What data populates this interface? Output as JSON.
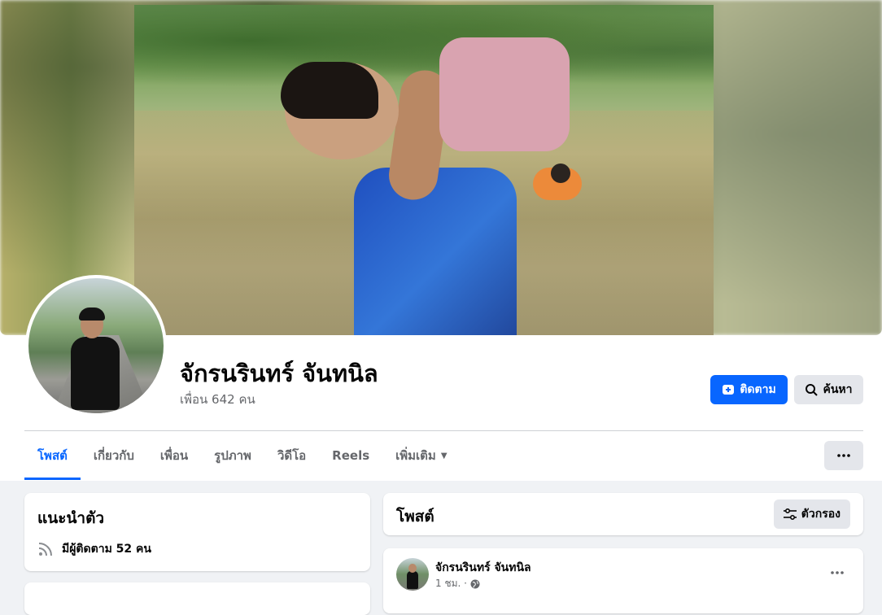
{
  "profile": {
    "name": "จักรนรินทร์ จันทนิล",
    "friends_text": "เพื่อน 642 คน"
  },
  "actions": {
    "follow_label": "ติดตาม",
    "search_label": "ค้นหา",
    "follow_icon": "follow-plus-icon",
    "search_icon": "search-icon"
  },
  "tabs": [
    {
      "label": "โพสต์",
      "active": true
    },
    {
      "label": "เกี่ยวกับ",
      "active": false
    },
    {
      "label": "เพื่อน",
      "active": false
    },
    {
      "label": "รูปภาพ",
      "active": false
    },
    {
      "label": "วิดีโอ",
      "active": false
    },
    {
      "label": "Reels",
      "active": false
    },
    {
      "label": "เพิ่มเติม",
      "active": false
    }
  ],
  "intro": {
    "title": "แนะนำตัว",
    "followers_text": "มีผู้ติดตาม 52 คน"
  },
  "posts": {
    "title": "โพสต์",
    "filter_label": "ตัวกรอง"
  },
  "post": {
    "author": "จักรนรินทร์ จันทนิล",
    "time": "1 ชม. ·"
  },
  "colors": {
    "accent": "#0866ff",
    "secondary_button": "#e4e6eb",
    "muted_text": "#65676b"
  }
}
